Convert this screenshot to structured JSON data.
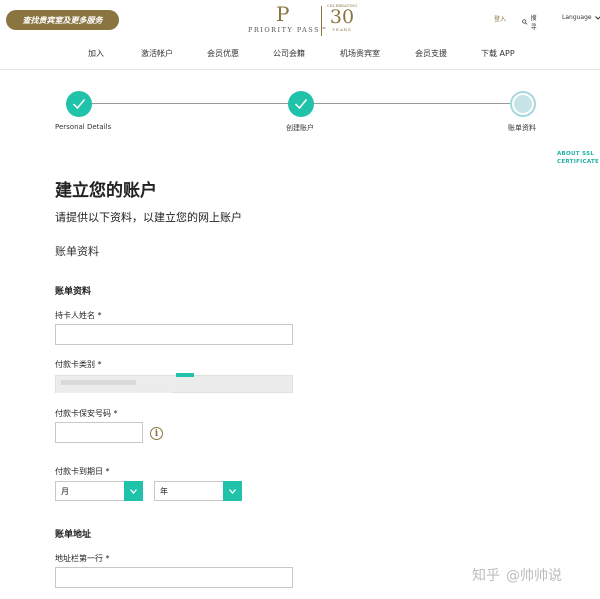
{
  "header": {
    "find_button": "查找贵宾室及更多服务",
    "logo": {
      "brand": "PRIORITY PASS™",
      "celebrating": "CELEBRATING",
      "number": "30",
      "years": "YEARS"
    },
    "login": "登入",
    "search": "搜寻",
    "language": "Language"
  },
  "nav": [
    "加入",
    "激活帐户",
    "会员优惠",
    "公司会籍",
    "机场贵宾室",
    "会员支援",
    "下载 APP"
  ],
  "progress": {
    "steps": [
      {
        "label": "Personal Details",
        "state": "done"
      },
      {
        "label": "创建账户",
        "state": "done"
      },
      {
        "label": "账单资料",
        "state": "current"
      }
    ]
  },
  "ssl_badge": {
    "line1": "ABOUT SSL",
    "line2": "CERTIFICATE"
  },
  "form": {
    "title": "建立您的账户",
    "subtitle": "请提供以下资料，以建立您的网上账户",
    "section_title": "账单资料",
    "billing_heading": "账单资料",
    "cardholder_label": "持卡人姓名 *",
    "cardholder_value": "",
    "card_type_label": "付款卡类别 *",
    "cvv_label": "付款卡保安号码 *",
    "expiry_label": "付款卡到期日 *",
    "month_value": "月",
    "year_value": "年",
    "address_heading": "账单地址",
    "address1_label": "地址栏第一行 *"
  },
  "watermark": {
    "site": "知乎",
    "author": "@帅帅说"
  },
  "colors": {
    "gold": "#8a7440",
    "teal": "#20c2a9"
  }
}
